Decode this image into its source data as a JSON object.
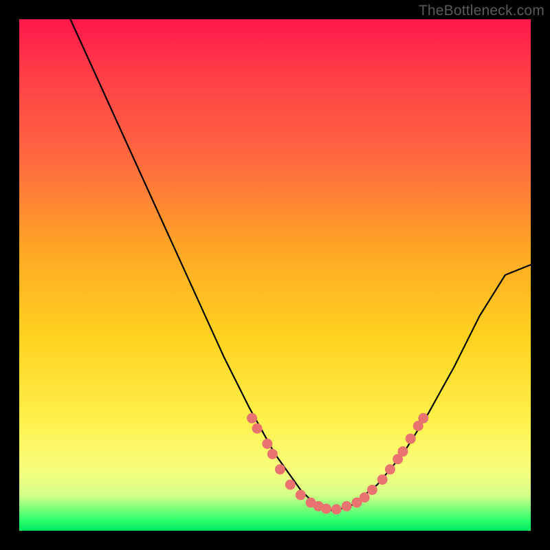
{
  "watermark": "TheBottleneck.com",
  "chart_data": {
    "type": "line",
    "title": "",
    "xlabel": "",
    "ylabel": "",
    "xlim": [
      0,
      100
    ],
    "ylim": [
      0,
      100
    ],
    "series": [
      {
        "name": "curve",
        "x": [
          10,
          15,
          20,
          25,
          30,
          35,
          40,
          45,
          50,
          55,
          58,
          60,
          62,
          65,
          70,
          75,
          80,
          85,
          90,
          95,
          100
        ],
        "y": [
          100,
          89,
          78,
          67,
          56,
          45,
          34,
          24,
          15,
          8,
          5,
          4,
          4,
          5,
          9,
          15,
          23,
          32,
          42,
          50,
          52
        ]
      }
    ],
    "markers": [
      {
        "x": 45.5,
        "y": 22
      },
      {
        "x": 46.5,
        "y": 20
      },
      {
        "x": 48.5,
        "y": 17
      },
      {
        "x": 49.5,
        "y": 15
      },
      {
        "x": 51,
        "y": 12
      },
      {
        "x": 53,
        "y": 9
      },
      {
        "x": 55,
        "y": 7
      },
      {
        "x": 57,
        "y": 5.5
      },
      {
        "x": 58.5,
        "y": 4.8
      },
      {
        "x": 60,
        "y": 4.3
      },
      {
        "x": 62,
        "y": 4.2
      },
      {
        "x": 64,
        "y": 4.8
      },
      {
        "x": 66,
        "y": 5.5
      },
      {
        "x": 67.5,
        "y": 6.5
      },
      {
        "x": 69,
        "y": 8
      },
      {
        "x": 71,
        "y": 10
      },
      {
        "x": 72.5,
        "y": 12
      },
      {
        "x": 74,
        "y": 14
      },
      {
        "x": 75,
        "y": 15.5
      },
      {
        "x": 76.5,
        "y": 18
      },
      {
        "x": 78,
        "y": 20.5
      },
      {
        "x": 79,
        "y": 22
      }
    ],
    "gradient_stops": [
      {
        "pos": 0,
        "color": "#ff174b"
      },
      {
        "pos": 50,
        "color": "#ffc423"
      },
      {
        "pos": 100,
        "color": "#00e55e"
      }
    ]
  }
}
